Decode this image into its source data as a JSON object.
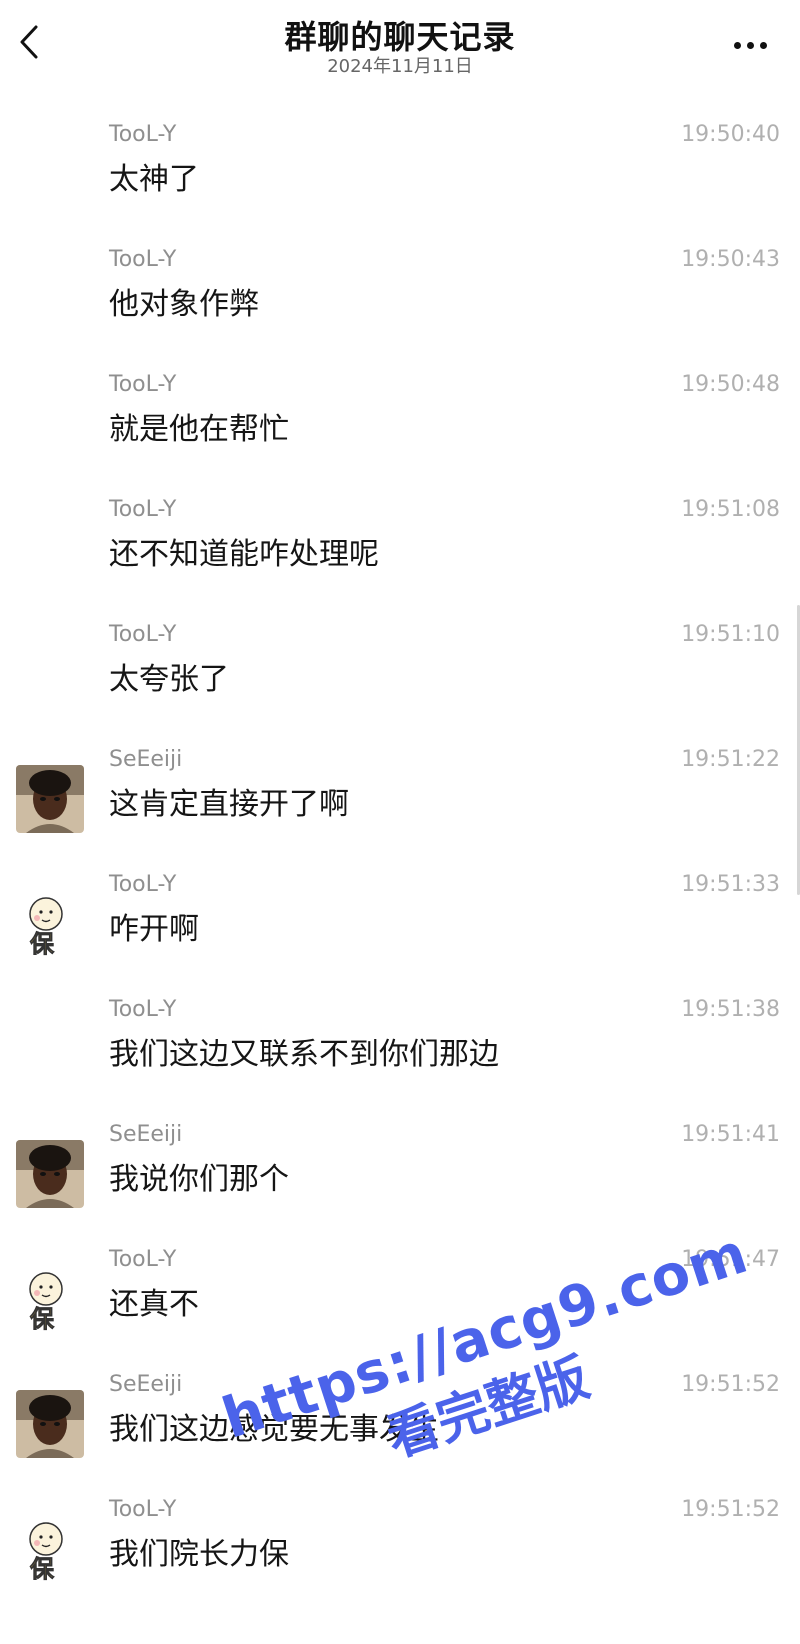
{
  "header": {
    "title": "群聊的聊天记录",
    "date": "2024年11月11日"
  },
  "messages": [
    {
      "sender": "TooL-Y",
      "time": "19:50:40",
      "text": "太神了",
      "avatar": "none"
    },
    {
      "sender": "TooL-Y",
      "time": "19:50:43",
      "text": "他对象作弊",
      "avatar": "none"
    },
    {
      "sender": "TooL-Y",
      "time": "19:50:48",
      "text": "就是他在帮忙",
      "avatar": "none"
    },
    {
      "sender": "TooL-Y",
      "time": "19:51:08",
      "text": "还不知道能咋处理呢",
      "avatar": "none"
    },
    {
      "sender": "TooL-Y",
      "time": "19:51:10",
      "text": "太夸张了",
      "avatar": "none"
    },
    {
      "sender": "SeEeiji",
      "time": "19:51:22",
      "text": "这肯定直接开了啊",
      "avatar": "photo"
    },
    {
      "sender": "TooL-Y",
      "time": "19:51:33",
      "text": "咋开啊",
      "avatar": "cartoon"
    },
    {
      "sender": "TooL-Y",
      "time": "19:51:38",
      "text": "我们这边又联系不到你们那边",
      "avatar": "none"
    },
    {
      "sender": "SeEeiji",
      "time": "19:51:41",
      "text": "我说你们那个",
      "avatar": "photo"
    },
    {
      "sender": "TooL-Y",
      "time": "19:51:47",
      "text": "还真不",
      "avatar": "cartoon"
    },
    {
      "sender": "SeEeiji",
      "time": "19:51:52",
      "text": "我们这边感觉要无事发生",
      "avatar": "photo"
    },
    {
      "sender": "TooL-Y",
      "time": "19:51:52",
      "text": "我们院长力保",
      "avatar": "cartoon"
    }
  ],
  "watermark": {
    "line1": "https://acg9.com",
    "line2": "看完整版"
  },
  "colors": {
    "watermark": "#4b63ea",
    "sender": "#8f8f8f",
    "time": "#b0b0b0"
  }
}
